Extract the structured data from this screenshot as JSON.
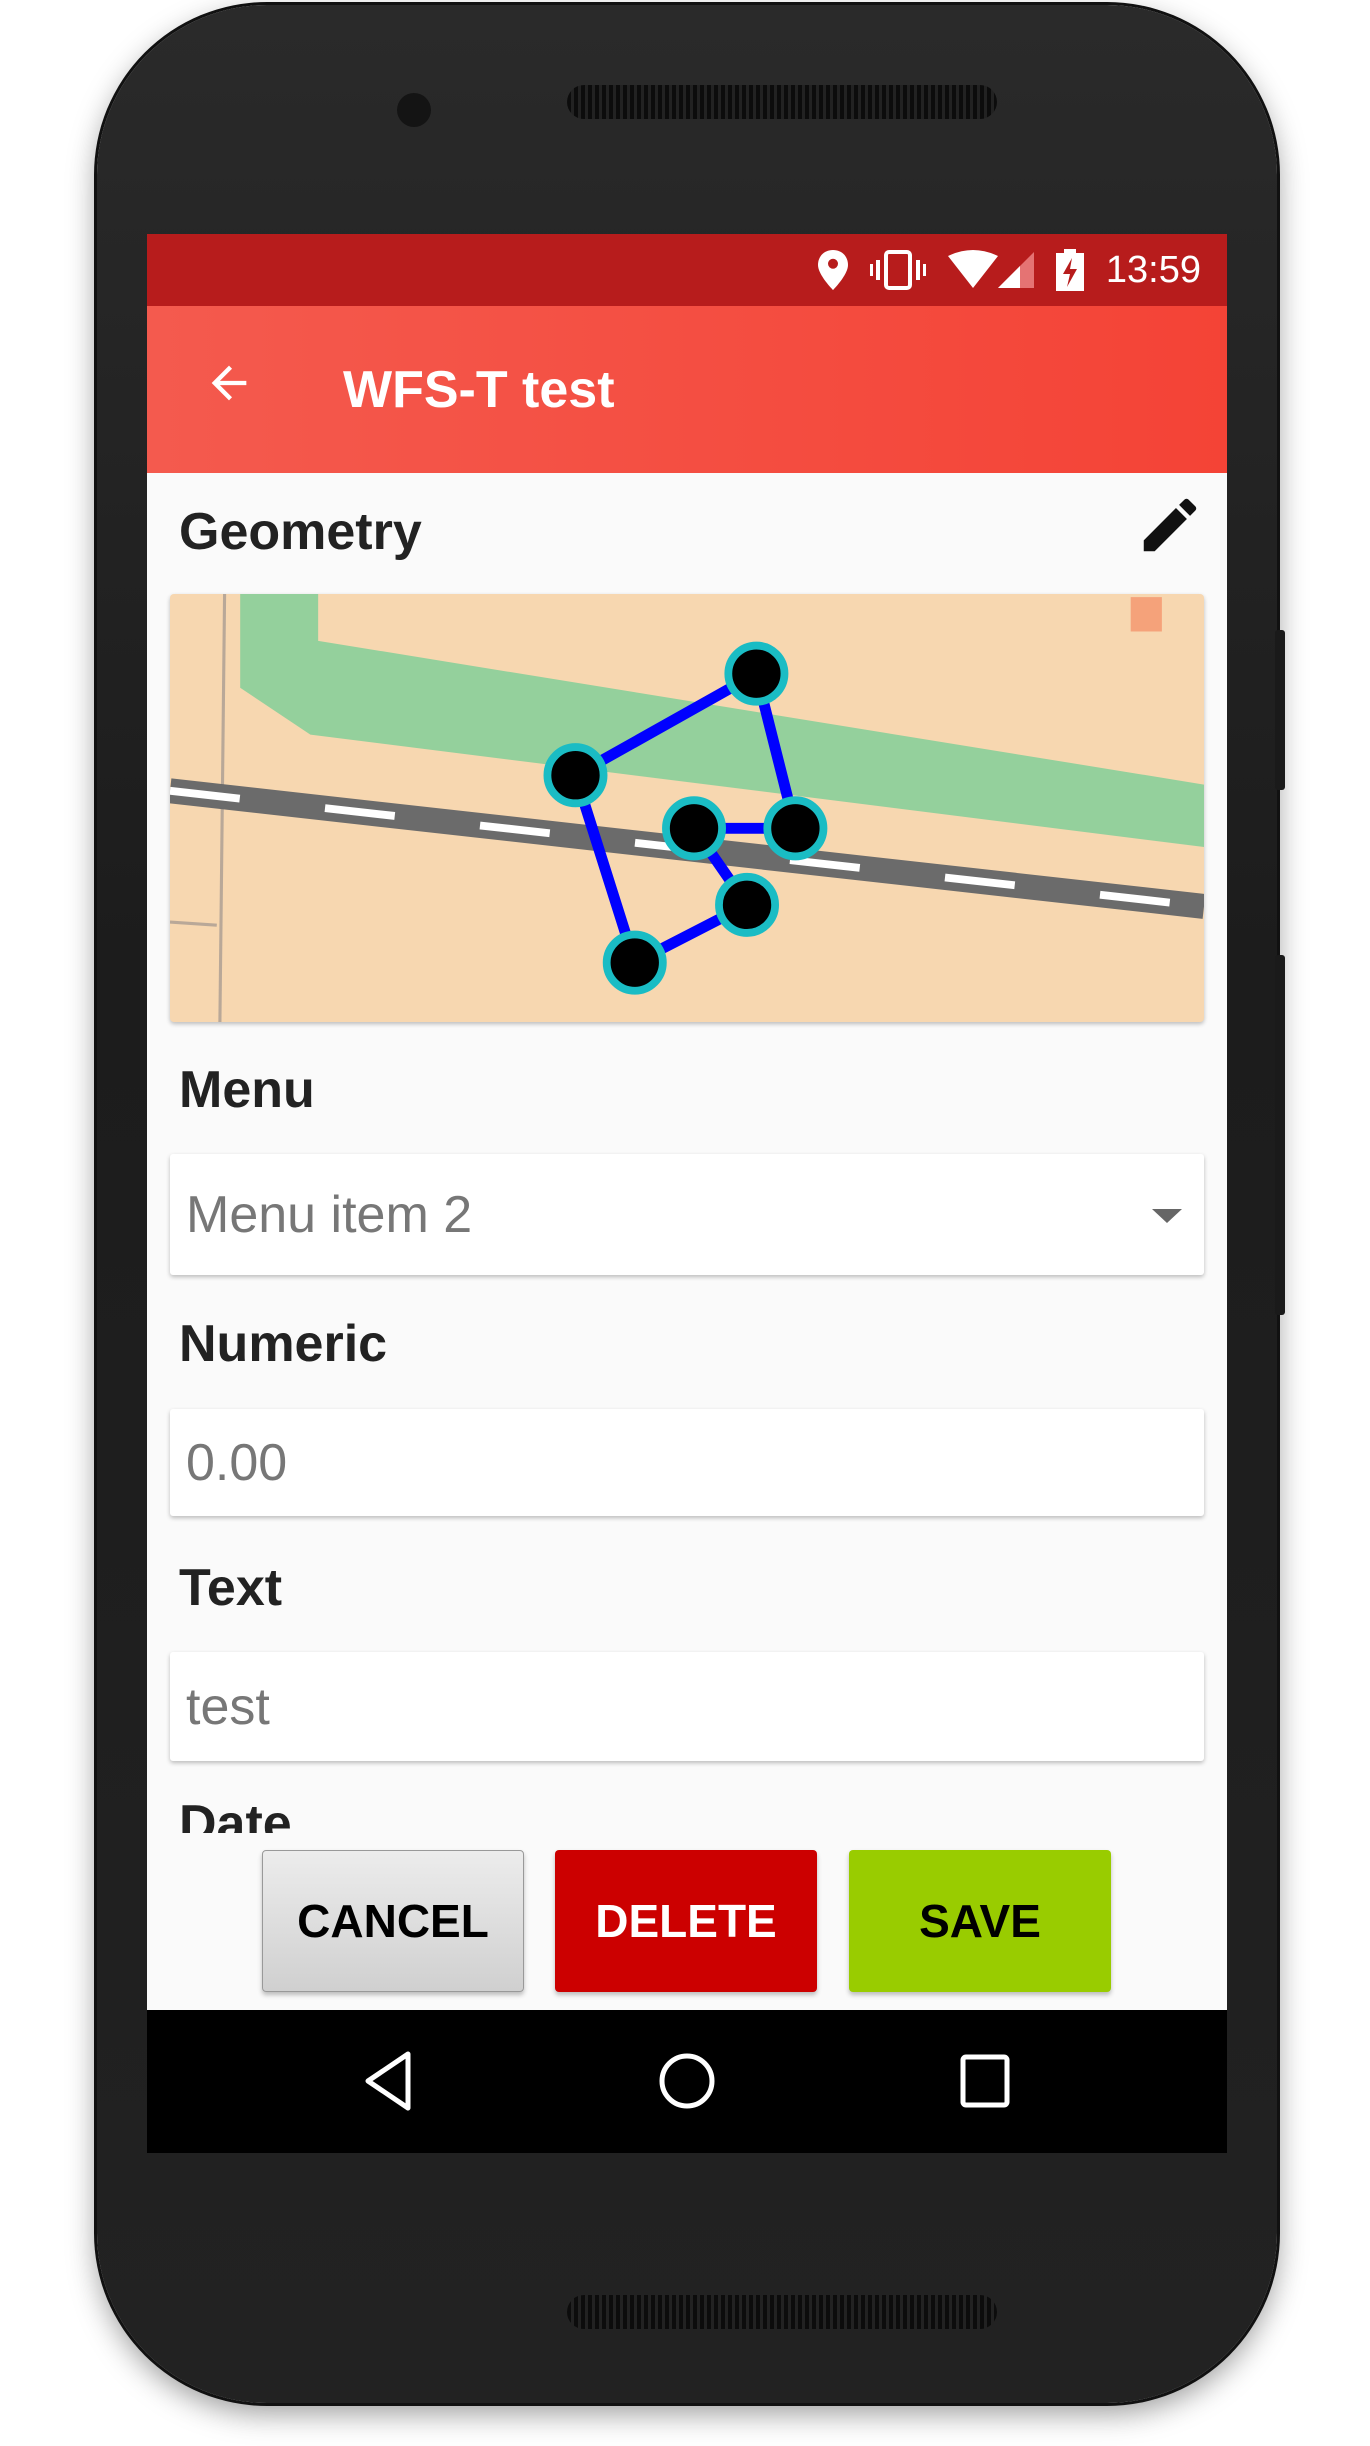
{
  "status_bar": {
    "time": "13:59",
    "icons": [
      "location-icon",
      "vibrate-icon",
      "wifi-icon",
      "signal-icon",
      "battery-charging-icon"
    ]
  },
  "app_bar": {
    "title": "WFS-T test",
    "back_icon": "arrow-back-icon"
  },
  "form": {
    "geometry": {
      "label": "Geometry",
      "edit_icon": "pencil-icon"
    },
    "menu": {
      "label": "Menu",
      "value": "Menu item 2"
    },
    "numeric": {
      "label": "Numeric",
      "value": "0.00"
    },
    "text": {
      "label": "Text",
      "value": "test"
    },
    "date": {
      "label": "Date"
    }
  },
  "buttons": {
    "cancel": "CANCEL",
    "delete": "DELETE",
    "save": "SAVE"
  },
  "colors": {
    "status_bar": "#b71c1c",
    "app_bar": "#f44336",
    "delete": "#cc0000",
    "save": "#99cc00",
    "geometry_line": "#0000ff",
    "vertex_ring": "#00bcd4"
  }
}
